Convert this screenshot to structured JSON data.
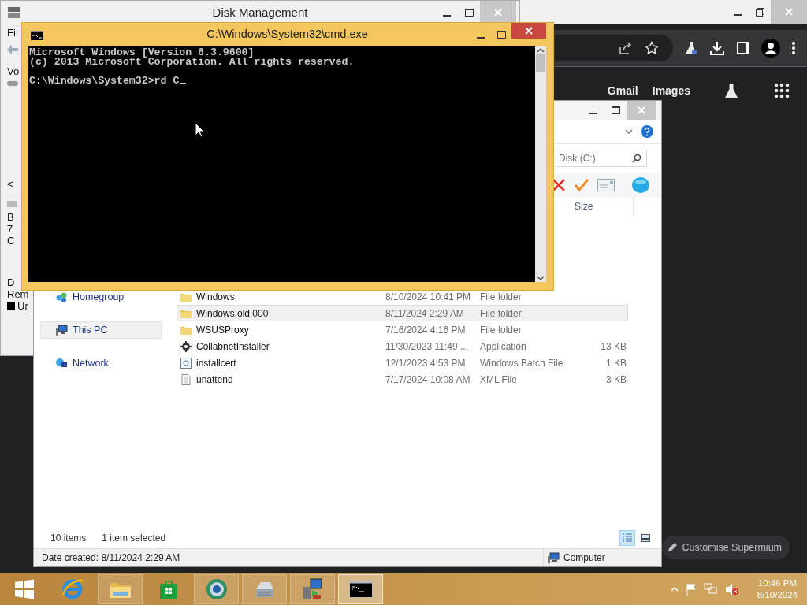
{
  "browser": {
    "links": [
      {
        "label": "Gmail"
      },
      {
        "label": "Images"
      }
    ],
    "customise_button": "Customise Supermium"
  },
  "disk_management": {
    "title": "Disk Management",
    "menu_fragment": "Fi",
    "column_fragment": "Vo",
    "scroll_left": "<",
    "disk_fragments": [
      "B",
      "7",
      "C"
    ],
    "removable_fragments": [
      "D",
      "Rem"
    ],
    "legend_fragment": "Ur"
  },
  "explorer": {
    "search": {
      "placeholder": "Disk (C:)"
    },
    "size_header": "Size",
    "nav": [
      {
        "label": "Homegroup",
        "kind": "homegroup",
        "selected": false
      },
      {
        "label": "This PC",
        "kind": "pc",
        "selected": true
      },
      {
        "label": "Network",
        "kind": "network",
        "selected": false
      }
    ],
    "files": [
      {
        "name": "Windows",
        "date": "8/10/2024 10:41 PM",
        "type": "File folder",
        "kind": "folder",
        "selected": false
      },
      {
        "name": "Windows.old.000",
        "date": "8/11/2024 2:29 AM",
        "type": "File folder",
        "kind": "folder",
        "selected": true
      },
      {
        "name": "WSUSProxy",
        "date": "7/16/2024 4:16 PM",
        "type": "File folder",
        "kind": "folder",
        "selected": false
      },
      {
        "name": "CollabnetInstaller",
        "date": "11/30/2023 11:49 ...",
        "type": "Application",
        "size": "13 KB",
        "kind": "application",
        "selected": false
      },
      {
        "name": "installcert",
        "date": "12/1/2023 4:53 PM",
        "type": "Windows Batch File",
        "size": "1 KB",
        "kind": "batch",
        "selected": false
      },
      {
        "name": "unattend",
        "date": "7/17/2024 10:08 AM",
        "type": "XML File",
        "size": "3 KB",
        "kind": "document",
        "selected": false
      }
    ],
    "status": {
      "count": "10 items",
      "selection": "1 item selected"
    },
    "views": [
      {
        "kind": "details",
        "selected": true
      },
      {
        "kind": "tiles",
        "selected": false
      }
    ],
    "details": "Date created: 8/11/2024 2:29 AM",
    "location": "Computer"
  },
  "console": {
    "title": "C:\\Windows\\System32\\cmd.exe",
    "output": [
      "Microsoft Windows [Version 6.3.9600]",
      "(c) 2013 Microsoft Corporation. All rights reserved."
    ],
    "prompt": "C:\\Windows\\System32>rd C"
  },
  "taskbar": {
    "apps": [
      {
        "kind": "start",
        "running": false,
        "selected": false
      },
      {
        "kind": "browser",
        "running": false,
        "selected": false
      },
      {
        "kind": "folder",
        "running": true,
        "selected": false
      },
      {
        "kind": "store",
        "running": false,
        "selected": false
      },
      {
        "kind": "globe",
        "running": true,
        "selected": false
      },
      {
        "kind": "drive",
        "running": true,
        "selected": false
      },
      {
        "kind": "installer",
        "running": true,
        "selected": false
      },
      {
        "kind": "console",
        "running": true,
        "selected": true
      }
    ],
    "time": "10:46 PM",
    "date": "8/10/2024"
  }
}
